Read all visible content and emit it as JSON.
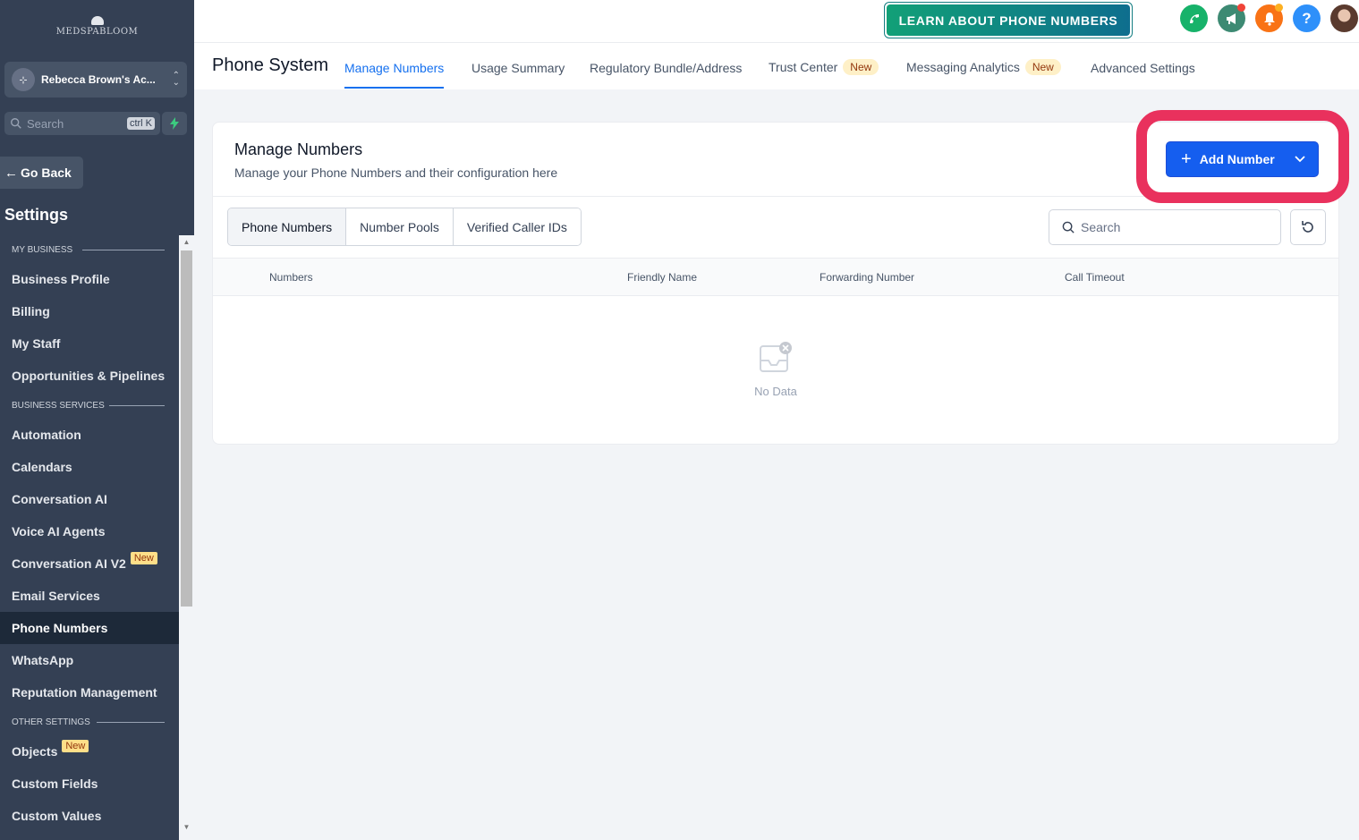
{
  "sidebar": {
    "logo": "MEDSPABLOOM",
    "account_name": "Rebecca Brown's Ac...",
    "search_placeholder": "Search",
    "search_shortcut": "ctrl K",
    "go_back": "Go Back",
    "title": "Settings",
    "sections": {
      "my_business": "MY BUSINESS",
      "business_services": "BUSINESS SERVICES",
      "other_settings": "OTHER SETTINGS"
    },
    "items": {
      "business_profile": "Business Profile",
      "billing": "Billing",
      "my_staff": "My Staff",
      "opportunities": "Opportunities & Pipelines",
      "automation": "Automation",
      "calendars": "Calendars",
      "conversation_ai": "Conversation AI",
      "voice_ai_agents": "Voice AI Agents",
      "conversation_ai_v2": "Conversation AI V2",
      "email_services": "Email Services",
      "phone_numbers": "Phone Numbers",
      "whatsapp": "WhatsApp",
      "reputation": "Reputation Management",
      "objects": "Objects",
      "custom_fields": "Custom Fields",
      "custom_values": "Custom Values"
    },
    "new_badge": "New"
  },
  "header": {
    "learn_button": "LEARN ABOUT PHONE NUMBERS",
    "icons": [
      "phone-icon",
      "megaphone-icon",
      "bell-icon",
      "help-icon",
      "user-avatar"
    ],
    "help_glyph": "?"
  },
  "subnav": {
    "title": "Phone System",
    "tabs": {
      "manage_numbers": "Manage Numbers",
      "usage_summary": "Usage Summary",
      "regulatory": "Regulatory Bundle/Address",
      "trust_center": "Trust Center",
      "messaging_analytics": "Messaging Analytics",
      "advanced_settings": "Advanced Settings"
    },
    "new_badge": "New"
  },
  "card": {
    "title": "Manage Numbers",
    "subtitle": "Manage your Phone Numbers and their configuration here",
    "add_button": "Add Number",
    "segments": {
      "phone_numbers": "Phone Numbers",
      "number_pools": "Number Pools",
      "verified_caller_ids": "Verified Caller IDs"
    },
    "search_placeholder": "Search",
    "columns": {
      "numbers": "Numbers",
      "friendly_name": "Friendly Name",
      "forwarding_number": "Forwarding Number",
      "call_timeout": "Call Timeout"
    },
    "empty_text": "No Data"
  },
  "colors": {
    "sidebar_bg": "#344054",
    "accent": "#155eef",
    "highlight": "#e9315d",
    "learn_green": "#12a077"
  }
}
